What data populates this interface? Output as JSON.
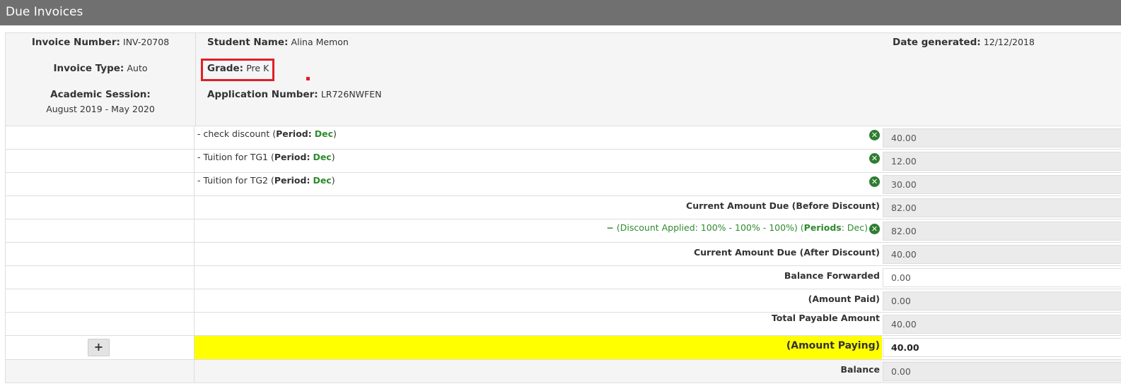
{
  "page": {
    "title": "Due Invoices"
  },
  "invoice": {
    "invoice_number_label": "Invoice Number:",
    "invoice_number": "INV-20708",
    "invoice_type_label": "Invoice Type:",
    "invoice_type": "Auto",
    "academic_session_label": "Academic Session:",
    "academic_session": "August 2019 - May 2020",
    "student_name_label": "Student Name:",
    "student_name": "Alina Memon",
    "grade_label": "Grade:",
    "grade": "Pre K",
    "application_number_label": "Application Number:",
    "application_number": "LR726NWFEN",
    "date_generated_label": "Date generated:",
    "date_generated": "12/12/2018"
  },
  "line_items": [
    {
      "name": "- check discount",
      "period_label": "Period:",
      "period": "Dec",
      "amount": "40.00"
    },
    {
      "name": "- Tuition for TG1",
      "period_label": "Period:",
      "period": "Dec",
      "amount": "12.00"
    },
    {
      "name": "- Tuition for TG2",
      "period_label": "Period:",
      "period": "Dec",
      "amount": "30.00"
    }
  ],
  "summary": {
    "before_discount_label": "Current Amount Due (Before Discount)",
    "before_discount": "82.00",
    "discount_text": "(Discount Applied: 100% - 100% - 100%)",
    "discount_periods_label": "Periods",
    "discount_periods": ": Dec)",
    "discount_open": " (",
    "discount_amount": "82.00",
    "after_discount_label": "Current Amount Due (After Discount)",
    "after_discount": "40.00",
    "balance_forwarded_label": "Balance Forwarded",
    "balance_forwarded": "0.00",
    "amount_paid_label": "(Amount Paid)",
    "amount_paid": "0.00",
    "total_payable_label": "Total Payable Amount",
    "total_payable": "40.00",
    "amount_paying_label": "(Amount Paying)",
    "amount_paying": "40.00",
    "balance_label": "Balance",
    "balance": "0.00"
  },
  "buttons": {
    "add": "+"
  },
  "icons": {
    "remove": "x-circle-icon",
    "minus": "minus-icon"
  },
  "colors": {
    "highlight": "#ffff00",
    "accent_green": "#2e8b2e",
    "annotation_red": "#e01f26",
    "topbar": "#707070"
  }
}
